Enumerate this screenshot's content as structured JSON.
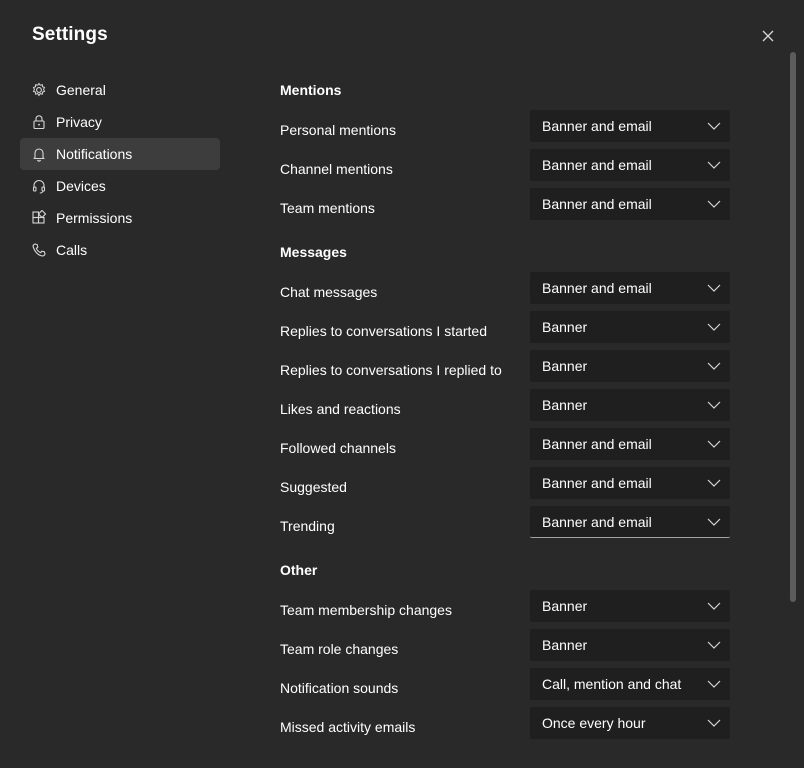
{
  "title": "Settings",
  "nav": [
    {
      "label": "General",
      "icon": "gear-icon"
    },
    {
      "label": "Privacy",
      "icon": "lock-icon"
    },
    {
      "label": "Notifications",
      "icon": "bell-icon"
    },
    {
      "label": "Devices",
      "icon": "headset-icon"
    },
    {
      "label": "Permissions",
      "icon": "grid-icon"
    },
    {
      "label": "Calls",
      "icon": "phone-icon"
    }
  ],
  "active_nav": "Notifications",
  "sections": {
    "mentions": {
      "title": "Mentions",
      "rows": [
        {
          "label": "Personal mentions",
          "value": "Banner and email"
        },
        {
          "label": "Channel mentions",
          "value": "Banner and email"
        },
        {
          "label": "Team mentions",
          "value": "Banner and email"
        }
      ]
    },
    "messages": {
      "title": "Messages",
      "rows": [
        {
          "label": "Chat messages",
          "value": "Banner and email"
        },
        {
          "label": "Replies to conversations I started",
          "value": "Banner"
        },
        {
          "label": "Replies to conversations I replied to",
          "value": "Banner"
        },
        {
          "label": "Likes and reactions",
          "value": "Banner"
        },
        {
          "label": "Followed channels",
          "value": "Banner and email"
        },
        {
          "label": "Suggested",
          "value": "Banner and email"
        },
        {
          "label": "Trending",
          "value": "Banner and email"
        }
      ]
    },
    "other": {
      "title": "Other",
      "rows": [
        {
          "label": "Team membership changes",
          "value": "Banner"
        },
        {
          "label": "Team role changes",
          "value": "Banner"
        },
        {
          "label": "Notification sounds",
          "value": "Call, mention and chat"
        },
        {
          "label": "Missed activity emails",
          "value": "Once every hour"
        }
      ]
    }
  },
  "colors": {
    "background": "#292929",
    "dropdown": "#1f1f1f",
    "nav_active": "#3d3d3d",
    "focus_underline": "#9c98e6"
  }
}
